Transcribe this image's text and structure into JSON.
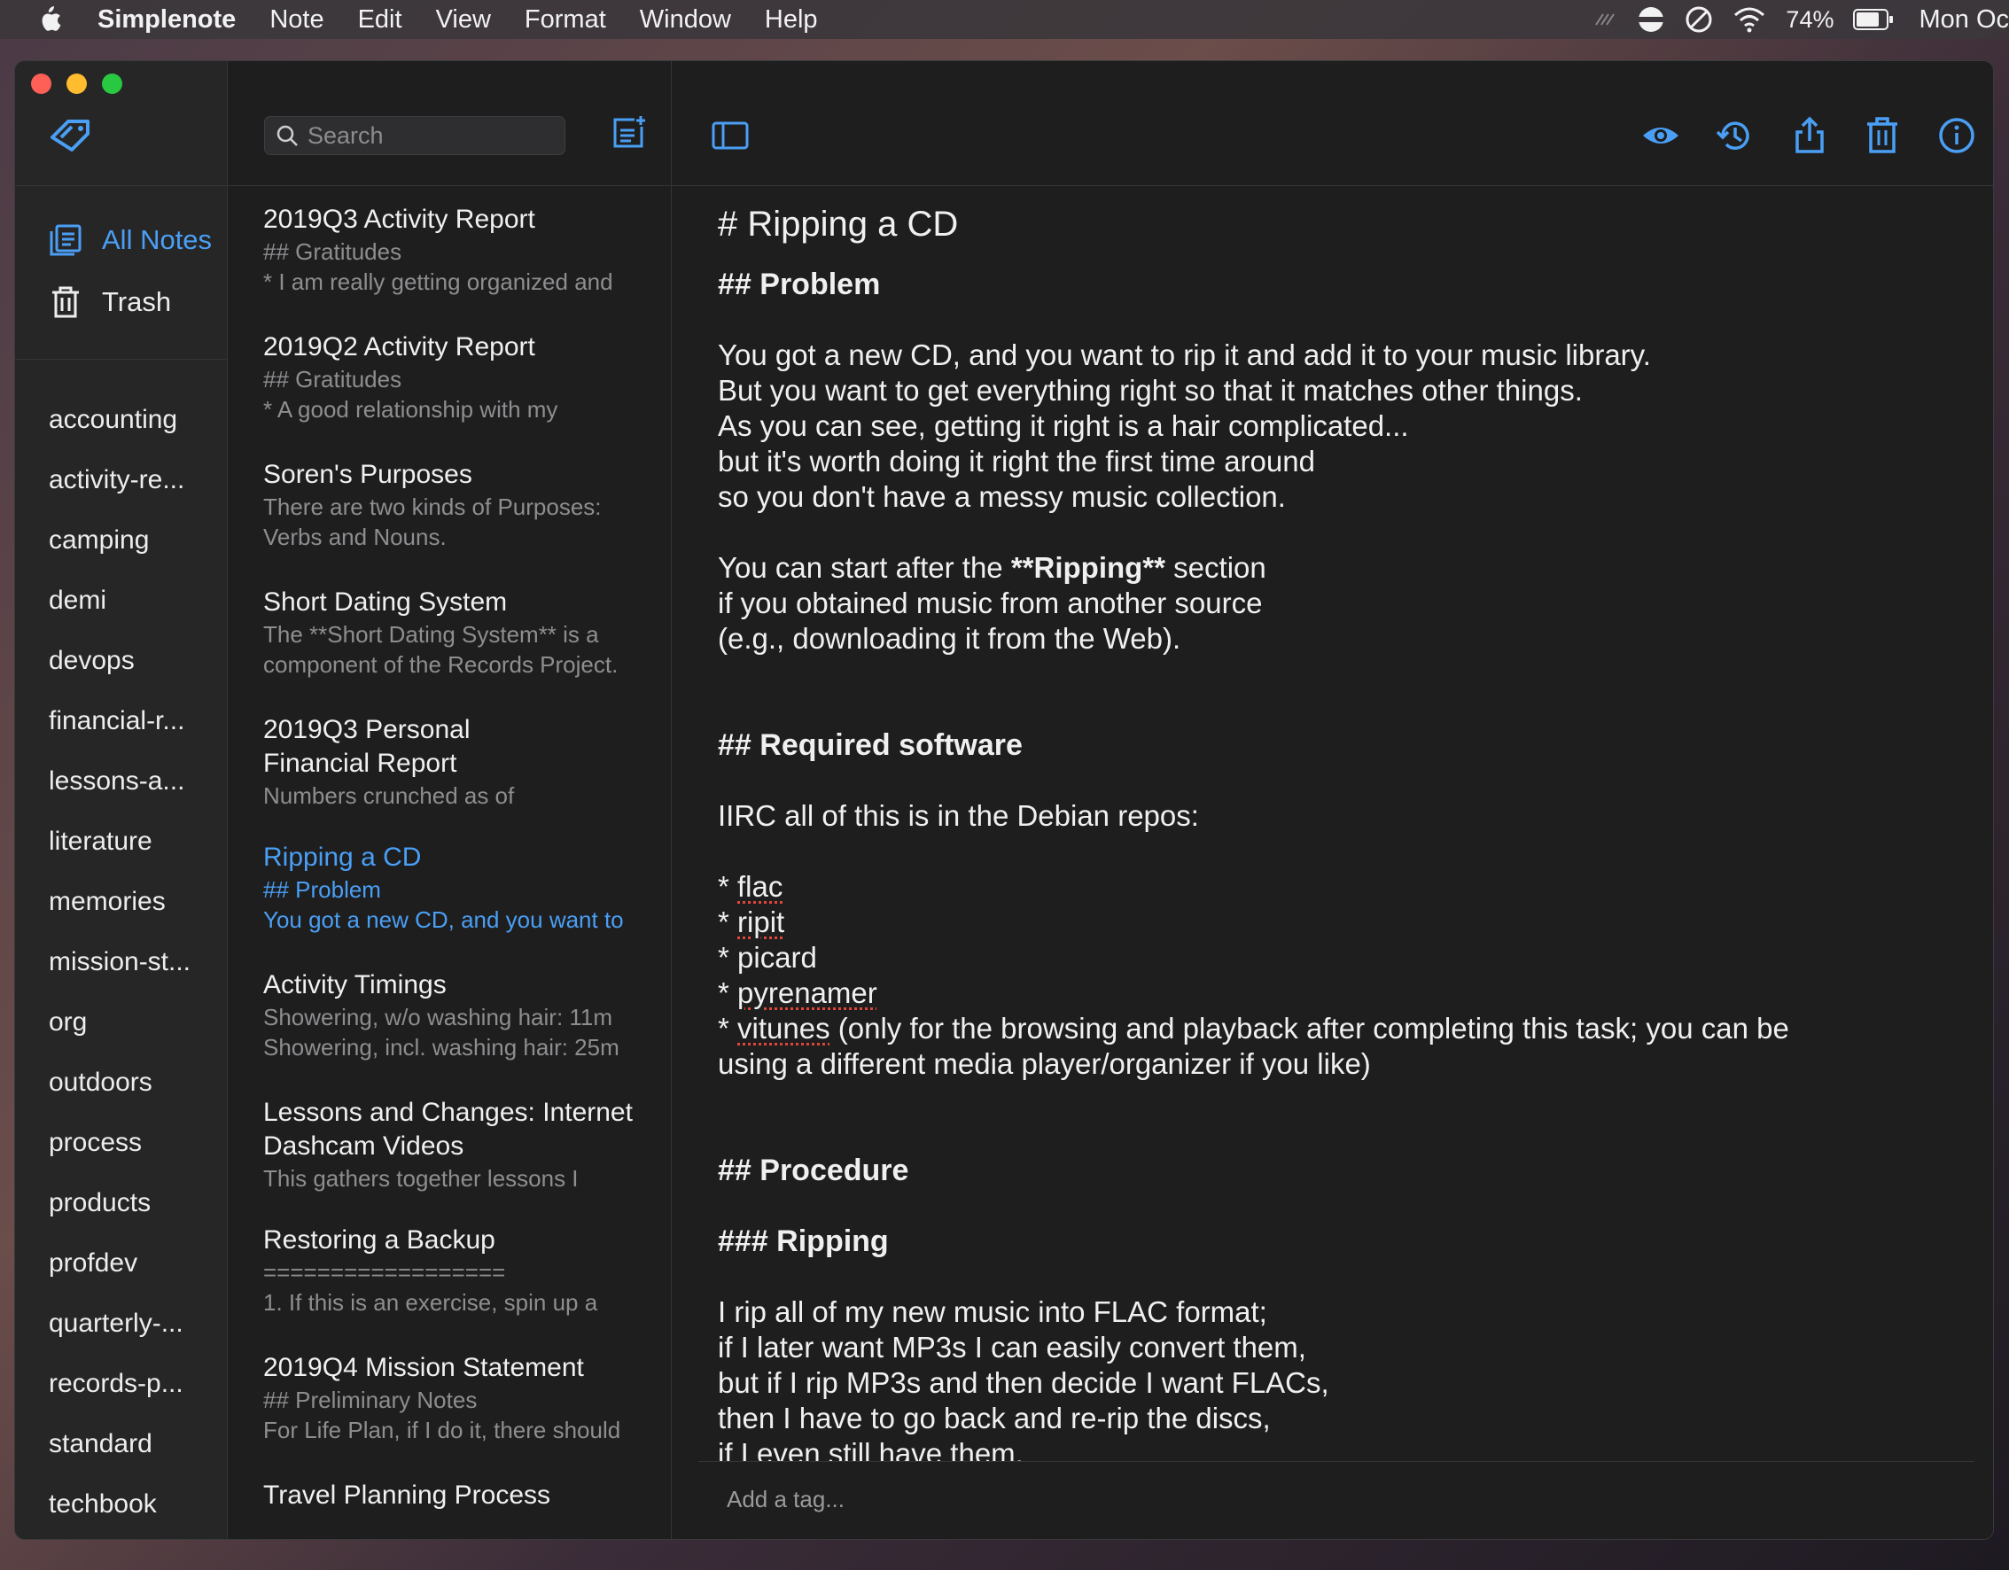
{
  "menubar": {
    "app_name": "Simplenote",
    "items": [
      "Note",
      "Edit",
      "View",
      "Format",
      "Window",
      "Help"
    ],
    "battery_percent": "74%",
    "clock": "Mon Oc"
  },
  "sidebar": {
    "all_notes": "All Notes",
    "trash": "Trash",
    "tags": [
      "accounting",
      "activity-re...",
      "camping",
      "demi",
      "devops",
      "financial-r...",
      "lessons-a...",
      "literature",
      "memories",
      "mission-st...",
      "org",
      "outdoors",
      "process",
      "products",
      "profdev",
      "quarterly-...",
      "records-p...",
      "standard",
      "techbook"
    ]
  },
  "search": {
    "placeholder": "Search"
  },
  "notes": [
    {
      "title": "2019Q3 Activity Report",
      "line1": "## Gratitudes",
      "line2": "* I am really getting organized and"
    },
    {
      "title": "2019Q2 Activity Report",
      "line1": "## Gratitudes",
      "line2": "* A good relationship with my"
    },
    {
      "title": "Soren's Purposes",
      "line1": "There are two kinds of Purposes:",
      "line2": "Verbs and Nouns."
    },
    {
      "title": "Short Dating System",
      "line1": "The **Short Dating System** is a",
      "line2": "component of the Records Project."
    },
    {
      "title": "2019Q3 Personal",
      "title2": "Financial Report",
      "line1": "Numbers crunched as of"
    },
    {
      "title": "Ripping a CD",
      "line1": "## Problem",
      "line2": "You got a new CD, and you want to"
    },
    {
      "title": "Activity Timings",
      "line1": "Showering, w/o washing hair: 11m",
      "line2": "Showering, incl. washing hair: 25m"
    },
    {
      "title": "Lessons and Changes: Internet",
      "title2": "Dashcam Videos",
      "line1": "This gathers together lessons I"
    },
    {
      "title": "Restoring a Backup",
      "line1": "==================",
      "line2": "1. If this is an exercise, spin up a"
    },
    {
      "title": "2019Q4 Mission Statement",
      "line1": "## Preliminary Notes",
      "line2": "For Life Plan, if I do it, there should"
    },
    {
      "title": "Travel Planning Process"
    }
  ],
  "editor": {
    "h1": "# Ripping a CD",
    "h_problem": "## Problem",
    "p1": [
      "You got a new CD, and you want to rip it and add it to your music library.",
      "But you want to get everything right so that it matches other things.",
      "As you can see, getting it right is a hair complicated...",
      "but it's worth doing it right the first time around",
      "so you don't have a messy music collection."
    ],
    "p2_a": "You can start after the ",
    "p2_bold": "**Ripping**",
    "p2_b": " section",
    "p2_rest": [
      "if you obtained music from another source",
      "(e.g., downloading it from the Web)."
    ],
    "h_software": "## Required software",
    "software_intro": "IIRC all of this is in the Debian repos:",
    "bullet": "* ",
    "sw": [
      "flac",
      "ripit",
      "picard",
      "pyrenamer",
      "vitunes"
    ],
    "vitunes_rest": " (only for the browsing and playback after completing this task; you can be",
    "vitunes_rest2": "using a different media player/organizer if you like)",
    "h_procedure": "## Procedure",
    "h_ripping": "### Ripping",
    "p3": [
      "I rip all of my new music into FLAC format;",
      "if I later want MP3s I can easily convert them,",
      "but if I rip MP3s and then decide I want FLACs,",
      "then I have to go back and re-rip the discs,",
      "if I even still have them."
    ]
  },
  "tagbar": {
    "placeholder": "Add a tag..."
  },
  "colors": {
    "accent": "#4a9ff5",
    "background": "#1e1e1f",
    "sidebar": "#262627"
  }
}
